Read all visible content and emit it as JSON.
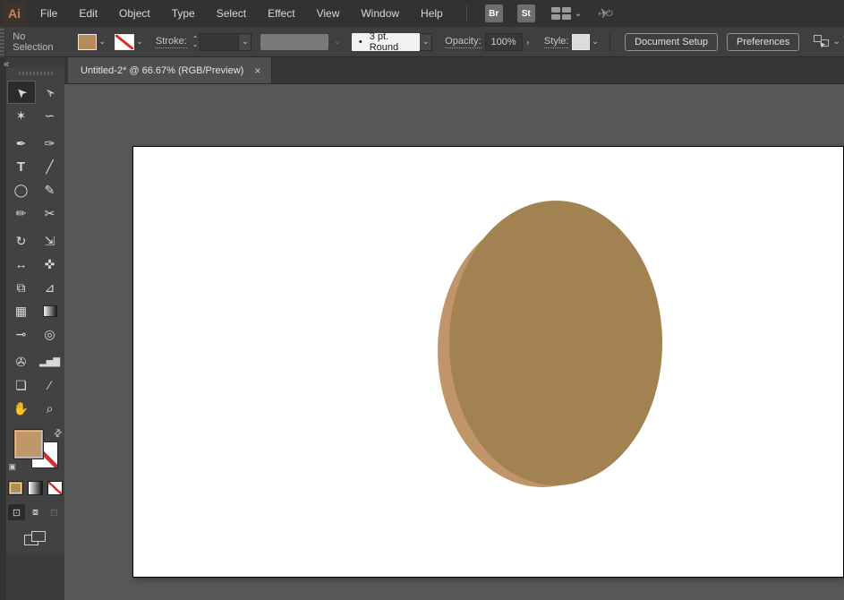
{
  "app": {
    "logo": "Ai"
  },
  "menu_bar": {
    "items": [
      "File",
      "Edit",
      "Object",
      "Type",
      "Select",
      "Effect",
      "View",
      "Window",
      "Help"
    ],
    "bridge_label": "Br",
    "stock_label": "St"
  },
  "control_bar": {
    "selection_status": "No Selection",
    "stroke_label": "Stroke:",
    "brush_bullet": "•",
    "brush_name": "3 pt. Round",
    "opacity_label": "Opacity:",
    "opacity_value": "100%",
    "style_label": "Style:",
    "document_setup_label": "Document Setup",
    "preferences_label": "Preferences"
  },
  "tab": {
    "title": "Untitled-2* @ 66.67% (RGB/Preview)",
    "close_glyph": "×"
  },
  "icons": {
    "collapse": "«",
    "chevron_down": "⌄",
    "chevron_right": "›",
    "stepper_up": "⌃",
    "stepper_down": "⌄",
    "swap": "⇄",
    "mini_swatches": "▣",
    "gpu": "✈",
    "gpu_power": "⏻",
    "draw_normal": "⊡",
    "draw_behind": "⧇",
    "draw_inside": "⊡"
  },
  "toolbar": {
    "tools": [
      {
        "name": "selection",
        "glyph": "➤",
        "active": true
      },
      {
        "name": "direct-selection",
        "glyph": "➢"
      },
      {
        "name": "magic-wand",
        "glyph": "✶"
      },
      {
        "name": "lasso",
        "glyph": "∽"
      },
      {
        "name": "pen",
        "glyph": "✒"
      },
      {
        "name": "curvature",
        "glyph": "✑"
      },
      {
        "name": "type",
        "glyph": "T"
      },
      {
        "name": "line-segment",
        "glyph": "╱"
      },
      {
        "name": "ellipse",
        "glyph": "◯"
      },
      {
        "name": "paintbrush",
        "glyph": "✎"
      },
      {
        "name": "shaper",
        "glyph": "✏"
      },
      {
        "name": "scissors",
        "glyph": "✂"
      },
      {
        "name": "rotate",
        "glyph": "↻"
      },
      {
        "name": "scale",
        "glyph": "⇲"
      },
      {
        "name": "width",
        "glyph": "↔"
      },
      {
        "name": "puppet-warp",
        "glyph": "✜"
      },
      {
        "name": "shape-builder",
        "glyph": "⧉"
      },
      {
        "name": "perspective-grid",
        "glyph": "⊿"
      },
      {
        "name": "mesh",
        "glyph": "▦"
      },
      {
        "name": "gradient",
        "glyph": ""
      },
      {
        "name": "eyedropper",
        "glyph": "⊸"
      },
      {
        "name": "blend",
        "glyph": "◎"
      },
      {
        "name": "symbol-sprayer",
        "glyph": "✇"
      },
      {
        "name": "column-graph",
        "glyph": "▂▅▇"
      },
      {
        "name": "artboard",
        "glyph": "❏"
      },
      {
        "name": "slice",
        "glyph": "∕"
      },
      {
        "name": "hand",
        "glyph": "✋"
      },
      {
        "name": "zoom",
        "glyph": "⌕"
      }
    ]
  },
  "colors": {
    "fill_swatch": "#B78C5C",
    "toolbar_fill_swatch": "#C0956A",
    "style_swatch": "#DCDCDC",
    "none_red": "#D32F2F",
    "logo_accent": "#CD8450",
    "shape_front": "#A38252",
    "shape_back": "#C0956A"
  },
  "canvas": {
    "zoom_percent": "66.67%",
    "color_mode": "RGB/Preview",
    "shapes": [
      {
        "type": "ellipse",
        "color": "#C0956A",
        "cx": "457",
        "cy": "228",
        "rx": "117",
        "ry": "152"
      },
      {
        "type": "ellipse",
        "color": "#A38252",
        "cx": "472",
        "cy": "219",
        "rx": "119",
        "ry": "159"
      }
    ]
  }
}
